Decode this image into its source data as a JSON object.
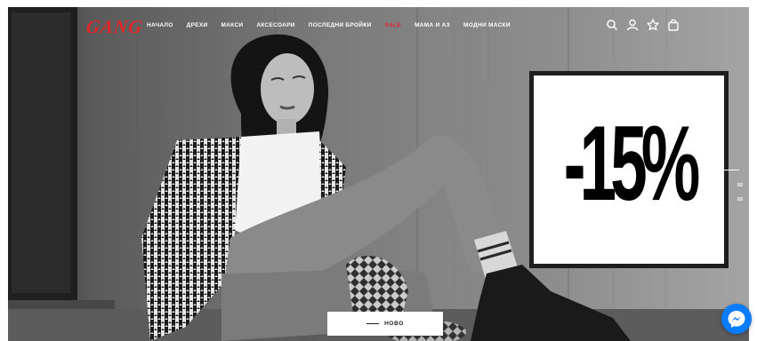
{
  "brand": {
    "logo_text": "GANG",
    "accent_color": "#e0262b"
  },
  "nav": {
    "items": [
      {
        "label": "НАЧАЛО"
      },
      {
        "label": "ДРЕХИ"
      },
      {
        "label": "МАКСИ"
      },
      {
        "label": "АКСЕСОАРИ"
      },
      {
        "label": "ПОСЛЕДНИ БРОЙКИ"
      },
      {
        "label": "SALE"
      },
      {
        "label": "МАМА И АЗ"
      },
      {
        "label": "МОДНИ МАСКИ"
      }
    ]
  },
  "header_icons": [
    "search-icon",
    "user-icon",
    "star-icon",
    "bag-icon"
  ],
  "hero": {
    "promo_text": "-15%",
    "slides": [
      {
        "label": "01"
      },
      {
        "label": "02"
      },
      {
        "label": "03"
      }
    ],
    "active_slide": 1,
    "cta_label": "НОВО"
  },
  "widgets": {
    "messenger_icon": "messenger-icon",
    "messenger_color": "#0a7cff"
  }
}
